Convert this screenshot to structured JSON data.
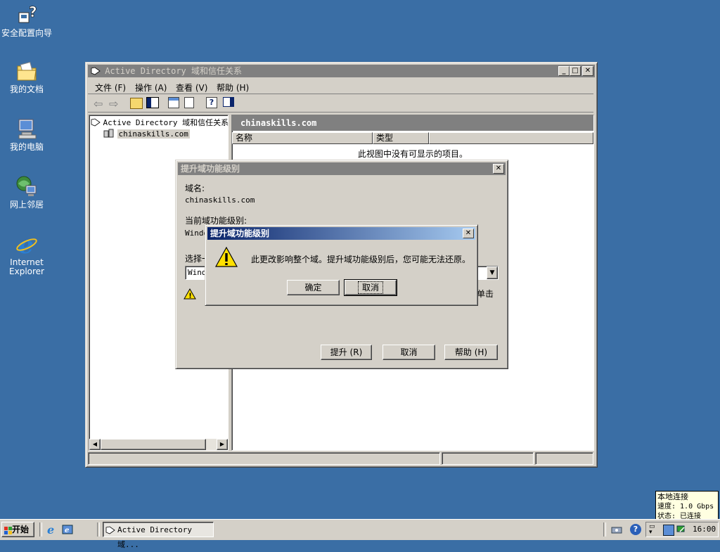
{
  "desktop": {
    "icons": [
      {
        "label": "安全配置向导"
      },
      {
        "label": "我的文档"
      },
      {
        "label": "我的电脑"
      },
      {
        "label": "网上邻居"
      },
      {
        "label": "Internet Explorer"
      }
    ]
  },
  "mmc": {
    "title": "Active Directory 域和信任关系",
    "menu": [
      "文件 (F)",
      "操作 (A)",
      "查看 (V)",
      "帮助 (H)"
    ],
    "tree": {
      "root": "Active Directory 域和信任关系",
      "child": "chinaskills.com"
    },
    "pane_header": "chinaskills.com",
    "columns": [
      "名称",
      "类型"
    ],
    "empty_text": "此视图中没有可显示的项目。"
  },
  "raise_dialog": {
    "title": "提升域功能级别",
    "domain_label": "域名:",
    "domain_value": "chinaskills.com",
    "current_label": "当前域功能级别:",
    "current_value_partial": "Windo",
    "select_label_partial": "选择一",
    "select_value_partial": "Wind",
    "hint_partial": "单击",
    "buttons": {
      "raise": "提升 (R)",
      "cancel": "取消",
      "help": "帮助 (H)"
    }
  },
  "confirm_dialog": {
    "title": "提升域功能级别",
    "message": "此更改影响整个域。提升域功能级别后，您可能无法还原。",
    "ok": "确定",
    "cancel": "取消"
  },
  "tooltip": {
    "line1": "本地连接",
    "line2": "速度: 1.0 Gbps",
    "line3": "状态: 已连接"
  },
  "taskbar": {
    "start": "开始",
    "task": "Active Directory 域...",
    "clock": "16:00"
  },
  "colors": {
    "desktop": "#3a6ea5",
    "face": "#d4d0c8",
    "active_title_start": "#0a246a",
    "active_title_end": "#a6caf0",
    "inactive_title": "#808080"
  }
}
